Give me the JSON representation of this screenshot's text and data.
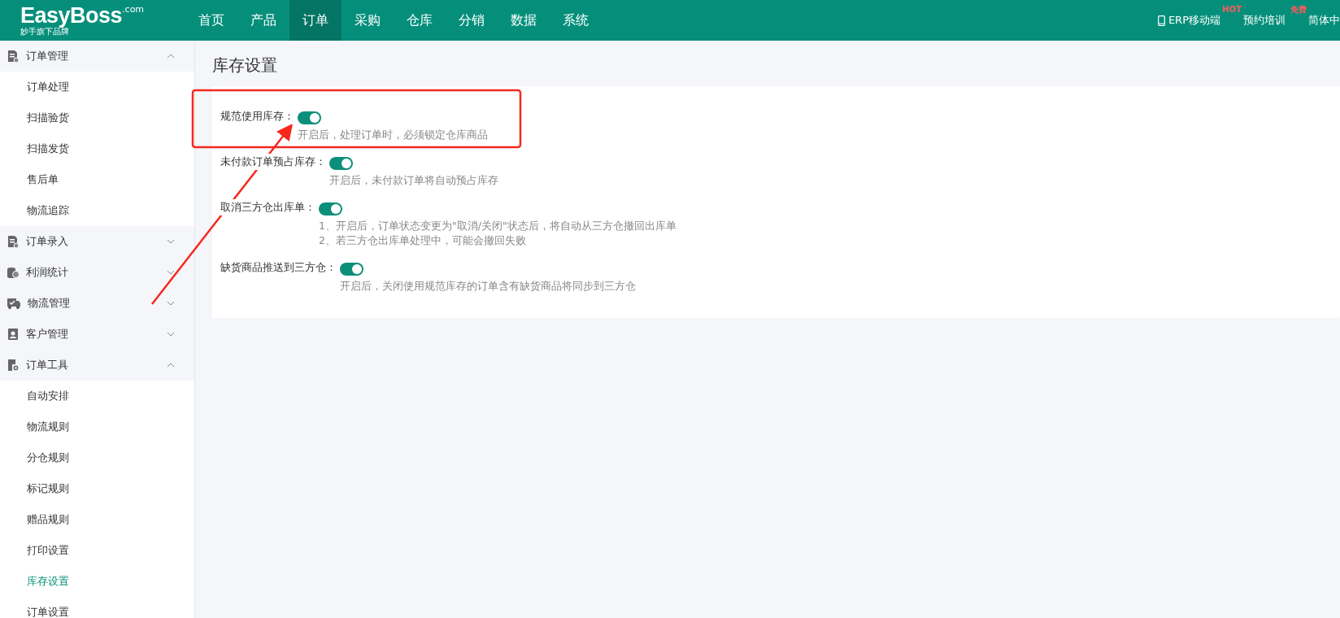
{
  "logo": {
    "name": "EasyBoss",
    "domain": ".com",
    "tagline": "妙手旗下品牌"
  },
  "nav": [
    {
      "label": "首页",
      "selected": false
    },
    {
      "label": "产品",
      "selected": false
    },
    {
      "label": "订单",
      "selected": true
    },
    {
      "label": "采购",
      "selected": false
    },
    {
      "label": "仓库",
      "selected": false
    },
    {
      "label": "分销",
      "selected": false
    },
    {
      "label": "数据",
      "selected": false
    },
    {
      "label": "系统",
      "selected": false
    }
  ],
  "header_links": [
    {
      "kind": "mobile",
      "label": "ERP移动端",
      "badge": "HOT"
    },
    {
      "kind": "plain",
      "label": "预约培训",
      "badge": "免费"
    },
    {
      "kind": "plain",
      "label": "简体中"
    }
  ],
  "sidebar": [
    {
      "label": "订单管理",
      "expanded": true,
      "children": [
        {
          "label": "订单处理",
          "selected": false
        },
        {
          "label": "扫描验货",
          "selected": false
        },
        {
          "label": "扫描发货",
          "selected": false
        },
        {
          "label": "售后单",
          "selected": false
        },
        {
          "label": "物流追踪",
          "selected": false
        }
      ]
    },
    {
      "label": "订单录入",
      "expanded": false
    },
    {
      "label": "利润统计",
      "expanded": false
    },
    {
      "label": "物流管理",
      "expanded": false
    },
    {
      "label": "客户管理",
      "expanded": false
    },
    {
      "label": "订单工具",
      "expanded": true,
      "children": [
        {
          "label": "自动安排",
          "selected": false
        },
        {
          "label": "物流规则",
          "selected": false
        },
        {
          "label": "分仓规则",
          "selected": false
        },
        {
          "label": "标记规则",
          "selected": false
        },
        {
          "label": "赠品规则",
          "selected": false
        },
        {
          "label": "打印设置",
          "selected": false
        },
        {
          "label": "库存设置",
          "selected": true
        },
        {
          "label": "订单设置",
          "selected": false
        }
      ]
    }
  ],
  "page_title": "库存设置",
  "settings": [
    {
      "label": "规范使用库存：",
      "on": true,
      "notes": [
        "开启后，处理订单时，必须锁定仓库商品"
      ]
    },
    {
      "label": "未付款订单预占库存：",
      "on": true,
      "notes": [
        "开启后，未付款订单将自动预占库存"
      ]
    },
    {
      "label": "取消三方仓出库单：",
      "on": true,
      "notes": [
        "1、开启后，订单状态变更为\"取消/关闭\"状态后，将自动从三方仓撤回出库单",
        "2、若三方仓出库单处理中，可能会撤回失败"
      ]
    },
    {
      "label": "缺货商品推送到三方仓：",
      "on": true,
      "notes": [
        "开启后，关闭使用规范库存的订单含有缺货商品将同步到三方仓"
      ]
    }
  ]
}
